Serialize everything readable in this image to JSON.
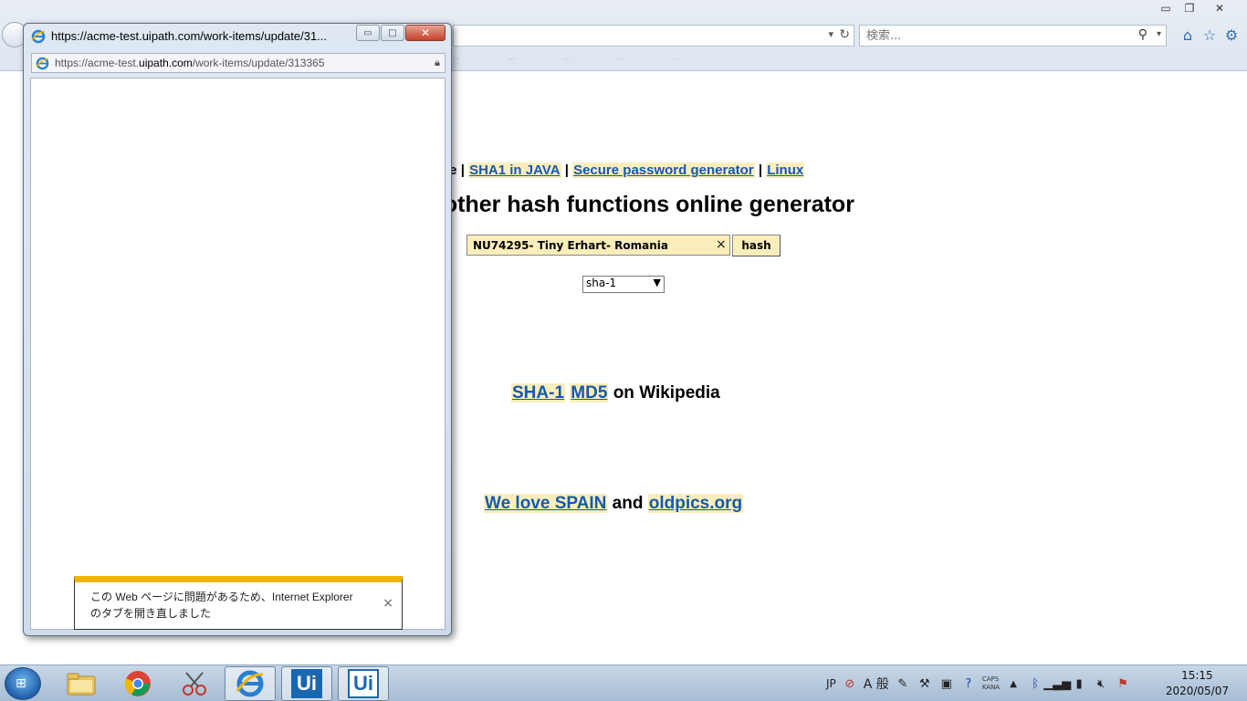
{
  "browser": {
    "search_placeholder": "検索...",
    "window_controls": {
      "minimize": "▭",
      "restore": "❐",
      "close": "✕"
    },
    "favorites_bar_items": [
      "...",
      "...",
      "...",
      "...",
      "..."
    ]
  },
  "page": {
    "nav_fragment": "ge",
    "nav_links": [
      "SHA1 in JAVA",
      "Secure password generator",
      "Linux"
    ],
    "separator": "|",
    "heading": "l other hash functions online generator",
    "hash_input_value": "NU74295- Tiny Erhart- Romania",
    "clear_glyph": "×",
    "hash_button": "hash",
    "algorithm_selected": "sha-1",
    "wiki": {
      "link1": "SHA-1",
      "link2": "MD5",
      "text": "on Wikipedia"
    },
    "spain": {
      "link1": "We love SPAIN",
      "and": "and",
      "link2": "oldpics.org"
    }
  },
  "popup": {
    "title": "https://acme-test.uipath.com/work-items/update/31...",
    "url_prefix": "https://acme-test.",
    "url_domain": "uipath.com",
    "url_path": "/work-items/update/313365",
    "notification": "この Web ページに問題があるため、Internet Explorer のタブを開き直しました",
    "notification_close": "×"
  },
  "taskbar": {
    "apps": [
      {
        "name": "file-explorer"
      },
      {
        "name": "chrome"
      },
      {
        "name": "snipping-tool"
      },
      {
        "name": "internet-explorer"
      },
      {
        "name": "uipath-studio",
        "label": "Ui"
      },
      {
        "name": "uipath-robot",
        "label": "Ui"
      }
    ],
    "language": "JP",
    "ime_mode": "A 般",
    "caps": "CAPS",
    "kana": "KANA",
    "time": "15:15",
    "date": "2020/05/07"
  },
  "colors": {
    "link": "#1558b0",
    "link_highlight": "#fbeebb",
    "notification_bar": "#f0b400",
    "uipath_blue": "#1a67b0"
  }
}
